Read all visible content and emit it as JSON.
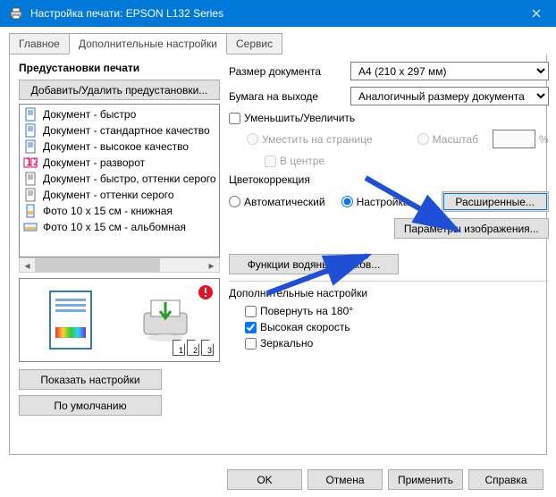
{
  "title": "Настройка печати: EPSON L132 Series",
  "tabs": [
    "Главное",
    "Дополнительные настройки",
    "Сервис"
  ],
  "activeTab": 1,
  "left": {
    "header": "Предустановки печати",
    "addRemove": "Добавить/Удалить предустановки...",
    "items": [
      "Документ - быстро",
      "Документ - стандартное качество",
      "Документ - высокое качество",
      "Документ - разворот",
      "Документ - быстро, оттенки серого",
      "Документ - оттенки серого",
      "Фото 10 x 15 см - книжная",
      "Фото 10 x 15 см - альбомная"
    ],
    "showSettings": "Показать настройки",
    "defaults": "По умолчанию"
  },
  "right": {
    "docSizeLabel": "Размер документа",
    "docSize": "A4 (210 x 297 мм)",
    "outPaperLabel": "Бумага на выходе",
    "outPaper": "Аналогичный размеру документа",
    "reduceEnlarge": "Уменьшить/Увеличить",
    "fitPage": "Уместить на странице",
    "scale": "Масштаб",
    "center": "В центре",
    "pct": "%",
    "colorCorr": "Цветокоррекция",
    "auto": "Автоматический",
    "custom": "Настройка",
    "advanced": "Расширенные...",
    "imageParams": "Параметры изображения...",
    "watermark": "Функции водяных знаков...",
    "addSettings": "Дополнительные настройки",
    "rotate180": "Повернуть на 180°",
    "highSpeed": "Высокая скорость",
    "mirror": "Зеркально"
  },
  "footer": {
    "ok": "OK",
    "cancel": "Отмена",
    "apply": "Применить",
    "help": "Справка"
  }
}
